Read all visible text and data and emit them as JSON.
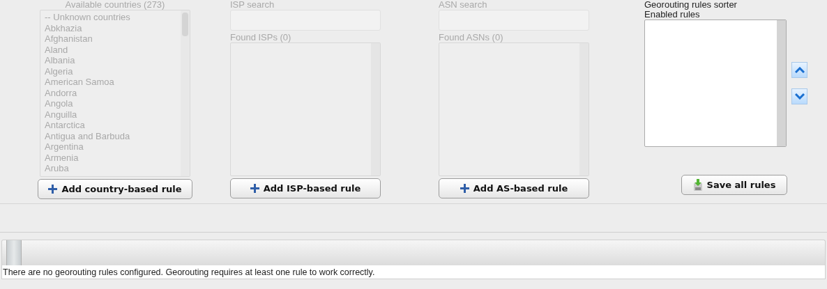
{
  "countries": {
    "label": "Available countries (273)",
    "disabled": true,
    "items": [
      "-- Unknown countries",
      "Abkhazia",
      "Afghanistan",
      "Aland",
      "Albania",
      "Algeria",
      "American Samoa",
      "Andorra",
      "Angola",
      "Anguilla",
      "Antarctica",
      "Antigua and Barbuda",
      "Argentina",
      "Armenia",
      "Aruba"
    ],
    "button": "Add country-based rule"
  },
  "isp": {
    "search_label": "ISP search",
    "found_label": "Found ISPs (0)",
    "disabled": true,
    "button": "Add ISP-based rule"
  },
  "asn": {
    "search_label": "ASN search",
    "found_label": "Found ASNs (0)",
    "disabled": true,
    "button": "Add AS-based rule"
  },
  "sorter": {
    "title": "Georouting rules sorter",
    "list_label": "Enabled rules",
    "button": "Save all rules"
  },
  "message": "There are no georouting rules configured. Georouting requires at least one rule to work correctly."
}
